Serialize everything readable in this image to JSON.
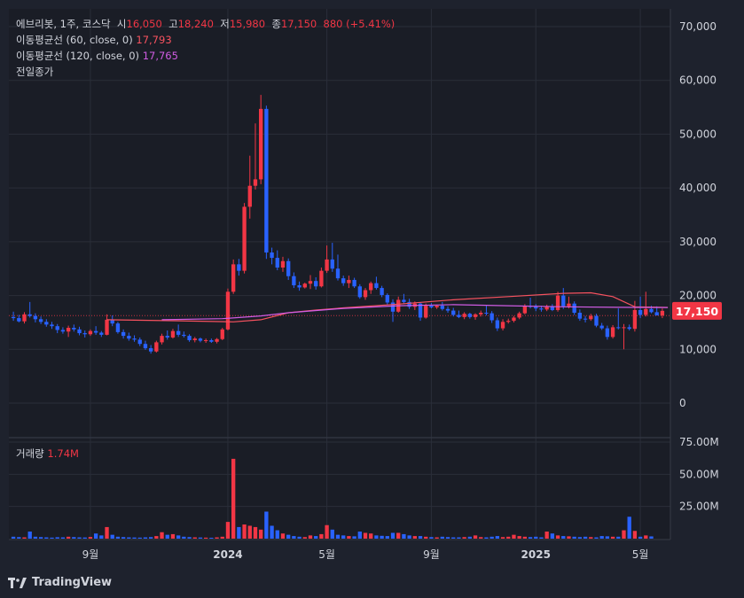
{
  "symbol": {
    "name": "에브리봇",
    "interval": "1주",
    "exchange": "코스닥",
    "open_label": "시",
    "open": "16,050",
    "high_label": "고",
    "high": "18,240",
    "low_label": "저",
    "low": "15,980",
    "close_label": "종",
    "close": "17,150",
    "change": "880 (+5.41%)"
  },
  "indicators": [
    {
      "label": "이동평균선 (60, close, 0)",
      "value": "17,793",
      "color": "#f7525f"
    },
    {
      "label": "이동평균선 (120, close, 0)",
      "value": "17,765",
      "color": "#d05ce3"
    },
    {
      "label": "전일종가",
      "value": ""
    }
  ],
  "volume_legend": {
    "label": "거래량",
    "value": "1.74M"
  },
  "price_tag": "17,150",
  "price_axis": [
    "70,000",
    "60,000",
    "50,000",
    "40,000",
    "30,000",
    "20,000",
    "10,000",
    "0"
  ],
  "volume_axis": [
    "75.00M",
    "50.00M",
    "25.00M"
  ],
  "time_axis": [
    "9월",
    "2024",
    "5월",
    "9월",
    "2025",
    "5월"
  ],
  "brand": "TradingView",
  "colors": {
    "up": "#f23645",
    "down": "#2962ff",
    "background": "#1e222d",
    "grid": "#2a2e39",
    "ma60": "#f7525f",
    "ma120": "#d05ce3"
  },
  "chart_data": {
    "type": "candlestick",
    "interval": "weekly",
    "ylim": [
      0,
      70000
    ],
    "volume_ylim": [
      0,
      75000000
    ],
    "series": [
      {
        "name": "price",
        "ohlc": [
          [
            16000,
            17000,
            15300,
            15800
          ],
          [
            15800,
            16400,
            15000,
            15200
          ],
          [
            15200,
            16900,
            14800,
            16500
          ],
          [
            16500,
            18800,
            15900,
            16200
          ],
          [
            16200,
            16700,
            15000,
            15600
          ],
          [
            15600,
            16100,
            14700,
            15100
          ],
          [
            15100,
            15600,
            14200,
            14600
          ],
          [
            14600,
            15100,
            13800,
            14300
          ],
          [
            14300,
            14700,
            13000,
            13600
          ],
          [
            13600,
            14100,
            12900,
            13300
          ],
          [
            13300,
            14400,
            12300,
            14000
          ],
          [
            14000,
            14600,
            13300,
            13700
          ],
          [
            13700,
            14200,
            12600,
            13000
          ],
          [
            13000,
            13500,
            12200,
            12800
          ],
          [
            12800,
            13700,
            12500,
            13400
          ],
          [
            13400,
            14300,
            12700,
            13100
          ],
          [
            13100,
            13400,
            12300,
            12700
          ],
          [
            12700,
            16500,
            12600,
            15500
          ],
          [
            15500,
            16300,
            14300,
            14800
          ],
          [
            14800,
            15100,
            12900,
            13200
          ],
          [
            13200,
            13700,
            12000,
            12500
          ],
          [
            12500,
            13100,
            11600,
            12000
          ],
          [
            12000,
            12600,
            11400,
            11800
          ],
          [
            11800,
            12200,
            10600,
            11000
          ],
          [
            11000,
            11600,
            9900,
            10200
          ],
          [
            10200,
            10800,
            9200,
            9600
          ],
          [
            9600,
            11600,
            9400,
            11300
          ],
          [
            11300,
            12900,
            10900,
            12500
          ],
          [
            12500,
            13500,
            11800,
            12200
          ],
          [
            12200,
            13800,
            12000,
            13400
          ],
          [
            13400,
            14600,
            12300,
            12700
          ],
          [
            12700,
            13300,
            12200,
            12500
          ],
          [
            12500,
            12800,
            11400,
            11700
          ],
          [
            11700,
            12300,
            11300,
            12000
          ],
          [
            12000,
            12200,
            11300,
            11600
          ],
          [
            11600,
            12000,
            11200,
            11700
          ],
          [
            11700,
            12000,
            11200,
            11400
          ],
          [
            11400,
            12100,
            11100,
            11900
          ],
          [
            11900,
            14000,
            11700,
            13700
          ],
          [
            13700,
            21300,
            13500,
            20700
          ],
          [
            20700,
            26700,
            20300,
            25800
          ],
          [
            25800,
            26800,
            23700,
            24600
          ],
          [
            24600,
            37200,
            24100,
            36500
          ],
          [
            36500,
            46000,
            34300,
            40400
          ],
          [
            40400,
            52000,
            39700,
            41600
          ],
          [
            41600,
            57300,
            40700,
            54700
          ],
          [
            54700,
            55300,
            26800,
            28000
          ],
          [
            28000,
            28900,
            25800,
            27000
          ],
          [
            27000,
            28400,
            24700,
            25200
          ],
          [
            25200,
            27200,
            24400,
            26400
          ],
          [
            26400,
            26900,
            22900,
            23600
          ],
          [
            23600,
            24300,
            21400,
            21900
          ],
          [
            21900,
            22600,
            20900,
            21500
          ],
          [
            21500,
            22400,
            21300,
            22200
          ],
          [
            22200,
            23800,
            21200,
            22700
          ],
          [
            22700,
            23400,
            21100,
            21700
          ],
          [
            21700,
            25200,
            21500,
            24600
          ],
          [
            24600,
            29300,
            24200,
            26700
          ],
          [
            26700,
            29800,
            24400,
            25000
          ],
          [
            25000,
            27600,
            22800,
            23200
          ],
          [
            23200,
            23700,
            21800,
            22300
          ],
          [
            22300,
            23700,
            21400,
            22900
          ],
          [
            22900,
            23300,
            21400,
            21700
          ],
          [
            21700,
            22100,
            19400,
            19700
          ],
          [
            19700,
            21400,
            19200,
            21000
          ],
          [
            21000,
            22600,
            20300,
            22300
          ],
          [
            22300,
            23500,
            21100,
            21400
          ],
          [
            21400,
            21800,
            19700,
            20100
          ],
          [
            20100,
            20400,
            18300,
            18700
          ],
          [
            18700,
            19300,
            15100,
            17000
          ],
          [
            17000,
            19800,
            16800,
            19200
          ],
          [
            19200,
            20300,
            18400,
            18800
          ],
          [
            18800,
            19400,
            17500,
            17900
          ],
          [
            17900,
            18900,
            17300,
            18500
          ],
          [
            18500,
            18700,
            15300,
            15900
          ],
          [
            15900,
            18500,
            15700,
            18100
          ],
          [
            18100,
            18600,
            17600,
            17800
          ],
          [
            17800,
            18300,
            17500,
            18100
          ],
          [
            18100,
            18800,
            17200,
            17500
          ],
          [
            17500,
            18000,
            16800,
            17200
          ],
          [
            17200,
            17700,
            16100,
            16400
          ],
          [
            16400,
            17200,
            15800,
            16000
          ],
          [
            16000,
            16900,
            15600,
            16600
          ],
          [
            16600,
            16800,
            15700,
            16000
          ],
          [
            16000,
            16700,
            15500,
            16500
          ],
          [
            16500,
            17200,
            16100,
            16800
          ],
          [
            16800,
            18100,
            16300,
            16700
          ],
          [
            16700,
            17100,
            14900,
            15400
          ],
          [
            15400,
            15900,
            13400,
            13900
          ],
          [
            13900,
            15600,
            13500,
            15100
          ],
          [
            15100,
            15700,
            14800,
            15300
          ],
          [
            15300,
            16200,
            15000,
            15900
          ],
          [
            15900,
            17000,
            15600,
            16700
          ],
          [
            16700,
            18400,
            16500,
            18100
          ],
          [
            18100,
            19600,
            17600,
            17900
          ],
          [
            17900,
            18400,
            17100,
            17600
          ],
          [
            17600,
            18100,
            17000,
            17400
          ],
          [
            17400,
            18300,
            17100,
            17900
          ],
          [
            17900,
            18400,
            17100,
            17300
          ],
          [
            17300,
            20700,
            17000,
            20000
          ],
          [
            20000,
            21400,
            17500,
            18000
          ],
          [
            18000,
            19800,
            17600,
            18500
          ],
          [
            18500,
            18900,
            16400,
            16800
          ],
          [
            16800,
            17400,
            15300,
            15700
          ],
          [
            15700,
            16200,
            15000,
            15600
          ],
          [
            15600,
            16600,
            15300,
            16200
          ],
          [
            16200,
            16600,
            14100,
            14400
          ],
          [
            14400,
            14900,
            13600,
            13900
          ],
          [
            13900,
            14400,
            11800,
            12300
          ],
          [
            12300,
            14500,
            12000,
            14100
          ],
          [
            14100,
            17600,
            13700,
            14000
          ],
          [
            14000,
            14700,
            10000,
            14100
          ],
          [
            14100,
            14600,
            13500,
            13800
          ],
          [
            13800,
            19000,
            13300,
            17300
          ],
          [
            17300,
            19800,
            15800,
            16400
          ],
          [
            16400,
            20700,
            16100,
            17500
          ],
          [
            17500,
            18100,
            16700,
            16900
          ],
          [
            16900,
            18000,
            16500,
            16300
          ],
          [
            16300,
            17600,
            15800,
            17150
          ]
        ]
      },
      {
        "name": "volume",
        "values": [
          1.5,
          1.2,
          1.0,
          5.5,
          1.5,
          1.2,
          1.0,
          0.8,
          1.1,
          1.0,
          1.5,
          1.2,
          1.0,
          0.9,
          1.3,
          4.0,
          2.5,
          9.0,
          3.0,
          1.5,
          1.2,
          1.0,
          0.9,
          0.8,
          1.0,
          1.2,
          2.0,
          5.0,
          3.0,
          3.5,
          2.5,
          1.5,
          1.2,
          1.0,
          0.9,
          0.8,
          0.7,
          1.0,
          1.5,
          13.0,
          62.0,
          9.0,
          11.0,
          10.0,
          9.0,
          7.0,
          21.0,
          10.0,
          6.5,
          4.0,
          3.0,
          2.0,
          1.5,
          1.2,
          2.5,
          2.0,
          3.5,
          10.5,
          7.0,
          3.0,
          2.5,
          2.0,
          1.8,
          5.5,
          4.5,
          4.0,
          2.5,
          2.2,
          2.0,
          4.5,
          4.5,
          3.5,
          2.5,
          2.0,
          2.0,
          1.5,
          1.2,
          1.0,
          1.5,
          1.2,
          1.0,
          1.0,
          1.2,
          1.5,
          2.5,
          1.2,
          1.0,
          1.5,
          2.0,
          1.2,
          1.5,
          3.0,
          2.0,
          1.5,
          1.2,
          1.5,
          1.0,
          5.5,
          4.0,
          2.5,
          2.0,
          1.8,
          1.5,
          1.2,
          1.5,
          1.2,
          1.0,
          2.0,
          1.8,
          1.5,
          1.5,
          6.5,
          17.0,
          6.0,
          1.5,
          2.5,
          1.74
        ]
      },
      {
        "name": "이동평균선 (60, close, 0)",
        "values": [
          [
            17,
            15500
          ],
          [
            30,
            15300
          ],
          [
            40,
            15100
          ],
          [
            45,
            15500
          ],
          [
            50,
            16800
          ],
          [
            55,
            17300
          ],
          [
            60,
            17700
          ],
          [
            70,
            18400
          ],
          [
            80,
            19200
          ],
          [
            90,
            19800
          ],
          [
            100,
            20400
          ],
          [
            105,
            20500
          ],
          [
            109,
            19800
          ],
          [
            113,
            17900
          ],
          [
            119,
            17793
          ]
        ]
      },
      {
        "name": "이동평균선 (120, close, 0)",
        "values": [
          [
            27,
            15500
          ],
          [
            38,
            15700
          ],
          [
            45,
            16200
          ],
          [
            50,
            16800
          ],
          [
            60,
            17600
          ],
          [
            70,
            18100
          ],
          [
            80,
            18300
          ],
          [
            90,
            18100
          ],
          [
            100,
            17900
          ],
          [
            110,
            17800
          ],
          [
            119,
            17765
          ]
        ]
      }
    ],
    "prev_close": 16270,
    "last_price": 17150
  }
}
